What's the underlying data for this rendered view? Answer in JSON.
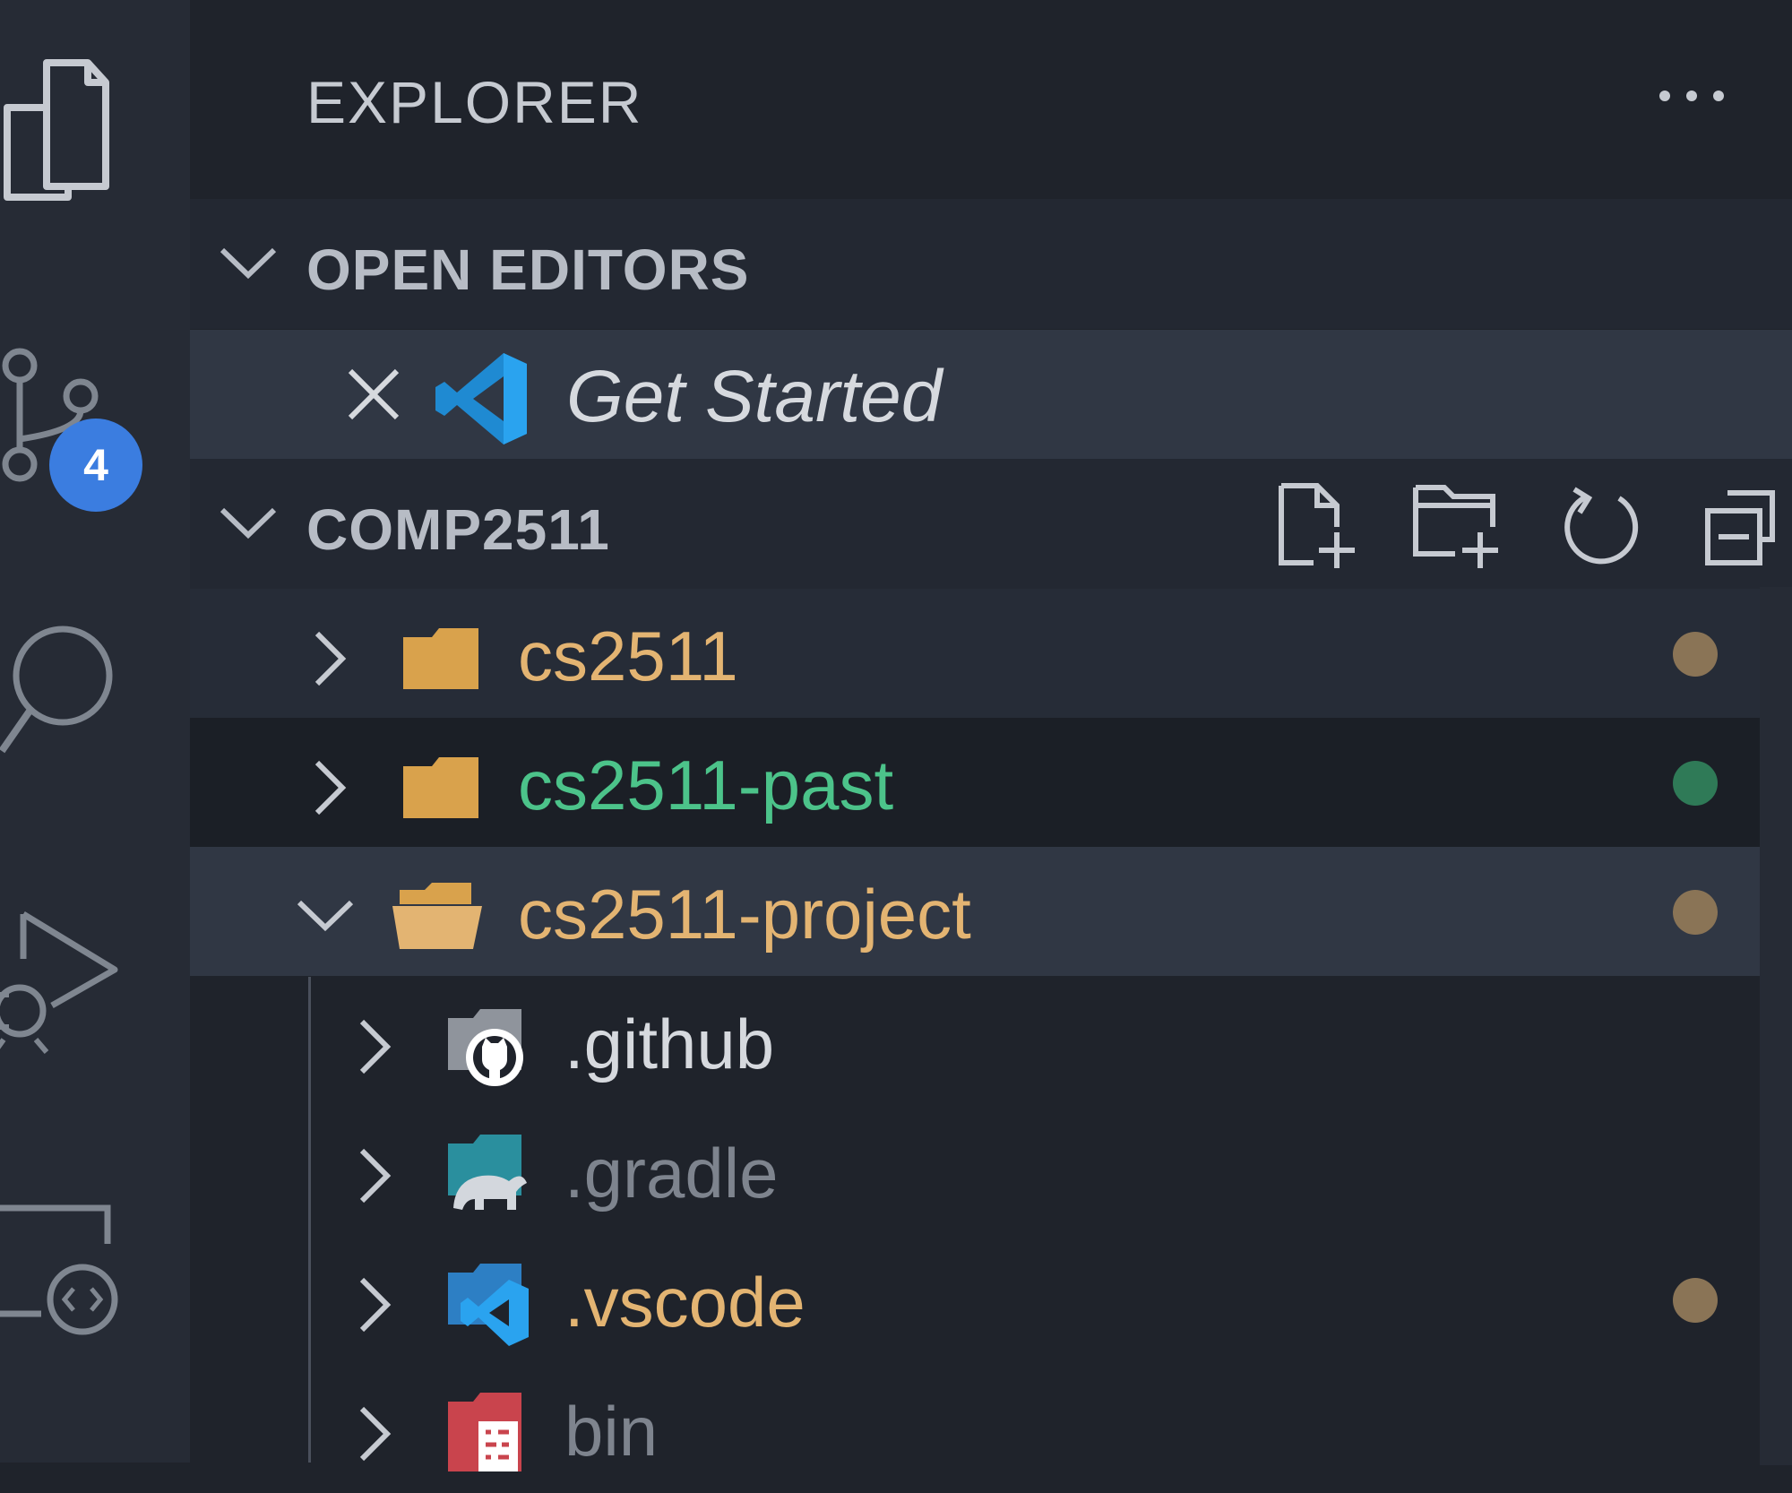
{
  "activity_bar": {
    "icons": [
      "files-icon",
      "source-control-icon",
      "search-icon",
      "run-debug-icon",
      "remote-explorer-icon"
    ],
    "source_control_badge": "4",
    "badge_color": "#3b7de0"
  },
  "explorer": {
    "title": "EXPLORER",
    "more_icon": "ellipsis-icon"
  },
  "open_editors": {
    "title": "OPEN EDITORS",
    "items": [
      {
        "label": "Get Started",
        "icon": "vscode-icon",
        "close_icon": "close-icon"
      }
    ]
  },
  "workspace": {
    "title": "COMP2511",
    "actions": [
      "new-file-icon",
      "new-folder-icon",
      "refresh-icon",
      "collapse-all-icon"
    ],
    "tree": [
      {
        "label": "cs2511",
        "color": "#e3b472",
        "status_dot": "#8a7456",
        "expanded": false
      },
      {
        "label": "cs2511-past",
        "color": "#4cc38a",
        "status_dot": "#2f7a57",
        "expanded": false
      },
      {
        "label": "cs2511-project",
        "color": "#e3b472",
        "status_dot": "#8a7456",
        "expanded": true
      },
      {
        "label": ".github",
        "color": "#d6d9de",
        "icon": "github-folder-icon",
        "expanded": false
      },
      {
        "label": ".gradle",
        "color": "#7e848e",
        "icon": "gradle-folder-icon",
        "expanded": false
      },
      {
        "label": ".vscode",
        "color": "#e3b472",
        "status_dot": "#8a7456",
        "icon": "vscode-folder-icon",
        "expanded": false
      },
      {
        "label": "bin",
        "color": "#7e848e",
        "icon": "bin-folder-icon",
        "expanded": false
      }
    ]
  }
}
